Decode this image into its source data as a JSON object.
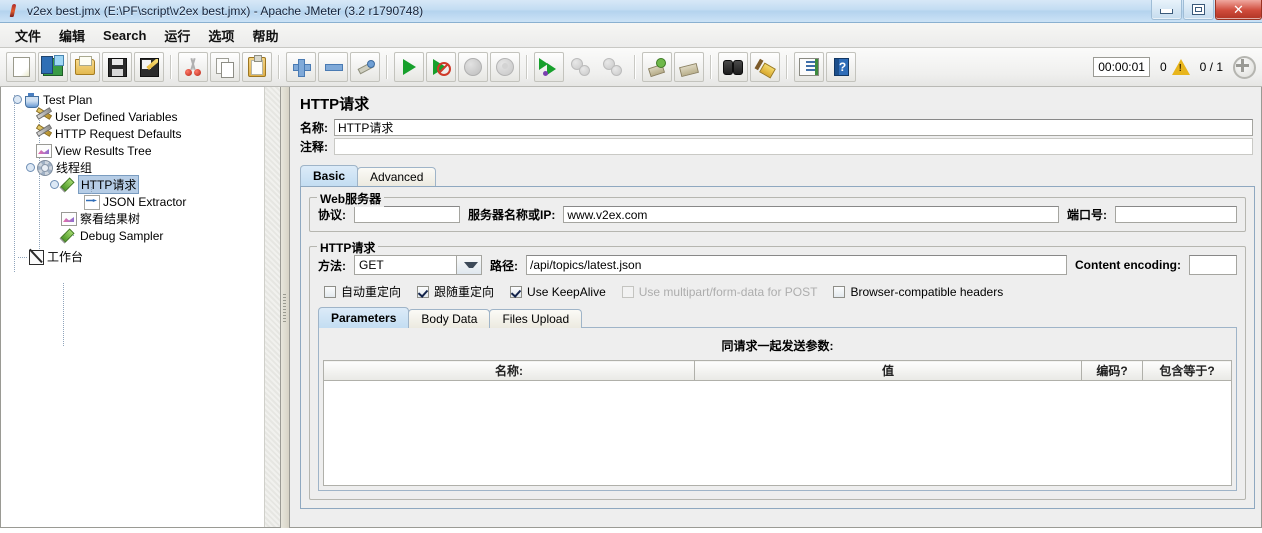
{
  "window": {
    "title": "v2ex best.jmx (E:\\PF\\script\\v2ex best.jmx) - Apache JMeter (3.2 r1790748)",
    "app_icon": "jmeter-feather-icon",
    "minimize_label": "",
    "maximize_label": "",
    "close_label": "✕"
  },
  "menubar": {
    "items": [
      {
        "label": "文件",
        "name": "menu-file"
      },
      {
        "label": "编辑",
        "name": "menu-edit"
      },
      {
        "label": "Search",
        "name": "menu-search"
      },
      {
        "label": "运行",
        "name": "menu-run"
      },
      {
        "label": "选项",
        "name": "menu-options"
      },
      {
        "label": "帮助",
        "name": "menu-help"
      }
    ]
  },
  "toolbar": {
    "buttons": [
      {
        "icon": "new-document-icon",
        "tooltip": "New"
      },
      {
        "icon": "templates-icon",
        "tooltip": "Templates"
      },
      {
        "icon": "open-folder-icon",
        "tooltip": "Open"
      },
      {
        "icon": "save-floppy-icon",
        "tooltip": "Save"
      },
      {
        "icon": "save-as-icon",
        "tooltip": "Save As"
      },
      {
        "icon": "cut-scissors-icon",
        "tooltip": "Cut"
      },
      {
        "icon": "copy-icon",
        "tooltip": "Copy"
      },
      {
        "icon": "paste-clipboard-icon",
        "tooltip": "Paste"
      },
      {
        "icon": "expand-plus-icon",
        "tooltip": "Expand All"
      },
      {
        "icon": "collapse-minus-icon",
        "tooltip": "Collapse All"
      },
      {
        "icon": "toggle-icon",
        "tooltip": "Toggle"
      },
      {
        "icon": "start-play-icon",
        "tooltip": "Start"
      },
      {
        "icon": "start-no-pauses-icon",
        "tooltip": "Start no pauses"
      },
      {
        "icon": "stop-circle-icon",
        "tooltip": "Stop"
      },
      {
        "icon": "shutdown-circle-icon",
        "tooltip": "Shutdown"
      },
      {
        "icon": "remote-start-all-icon",
        "tooltip": "Remote Start All"
      },
      {
        "icon": "remote-stop-all-icon",
        "tooltip": "Remote Stop All"
      },
      {
        "icon": "clear-icon",
        "tooltip": "Clear"
      },
      {
        "icon": "clear-all-icon",
        "tooltip": "Clear All"
      },
      {
        "icon": "search-binoculars-icon",
        "tooltip": "Search"
      },
      {
        "icon": "search-reset-broom-icon",
        "tooltip": "Reset Search"
      },
      {
        "icon": "function-helper-icon",
        "tooltip": "Function Helper Dialog"
      },
      {
        "icon": "help-book-icon",
        "tooltip": "Help"
      }
    ],
    "status": {
      "elapsed_time": "00:00:01",
      "warning_count": "0",
      "warning_icon": "warning-triangle-icon",
      "threads": "0 / 1",
      "connector_icon": "connection-status-icon"
    }
  },
  "tree": {
    "nodes": [
      {
        "label": "Test Plan",
        "icon": "test-plan-icon",
        "level": 0,
        "expanded": true,
        "selected": false,
        "name": "tree-node-test-plan"
      },
      {
        "label": "User Defined Variables",
        "icon": "config-element-icon",
        "level": 1,
        "expanded": null,
        "selected": false,
        "name": "tree-node-user-defined-variables"
      },
      {
        "label": "HTTP Request Defaults",
        "icon": "config-element-icon",
        "level": 1,
        "expanded": null,
        "selected": false,
        "name": "tree-node-http-request-defaults"
      },
      {
        "label": "View Results Tree",
        "icon": "listener-icon",
        "level": 1,
        "expanded": null,
        "selected": false,
        "name": "tree-node-view-results-tree"
      },
      {
        "label": "线程组",
        "icon": "thread-group-icon",
        "level": 1,
        "expanded": true,
        "selected": false,
        "name": "tree-node-thread-group"
      },
      {
        "label": "HTTP请求",
        "icon": "sampler-icon",
        "level": 2,
        "expanded": true,
        "selected": true,
        "name": "tree-node-http-request"
      },
      {
        "label": "JSON Extractor",
        "icon": "post-processor-icon",
        "level": 3,
        "expanded": null,
        "selected": false,
        "name": "tree-node-json-extractor"
      },
      {
        "label": "察看结果树",
        "icon": "listener-icon",
        "level": 2,
        "expanded": null,
        "selected": false,
        "name": "tree-node-view-results-tree-cn"
      },
      {
        "label": "Debug Sampler",
        "icon": "sampler-icon",
        "level": 2,
        "expanded": null,
        "selected": false,
        "name": "tree-node-debug-sampler"
      },
      {
        "label": "工作台",
        "icon": "workbench-icon",
        "level": 0,
        "expanded": null,
        "selected": false,
        "name": "tree-node-workbench"
      }
    ]
  },
  "detail": {
    "title": "HTTP请求",
    "name_label": "名称:",
    "name_value": "HTTP请求",
    "comment_label": "注释:",
    "comment_value": "",
    "tabs": [
      {
        "label": "Basic",
        "active": true
      },
      {
        "label": "Advanced",
        "active": false
      }
    ],
    "web_server": {
      "legend": "Web服务器",
      "protocol_label": "协议:",
      "protocol_value": "",
      "server_label": "服务器名称或IP:",
      "server_value": "www.v2ex.com",
      "port_label": "端口号:",
      "port_value": ""
    },
    "http_request": {
      "legend": "HTTP请求",
      "method_label": "方法:",
      "method_value": "GET",
      "path_label": "路径:",
      "path_value": "/api/topics/latest.json",
      "content_encoding_label": "Content encoding:",
      "content_encoding_value": ""
    },
    "checkboxes": [
      {
        "label": "自动重定向",
        "checked": false,
        "disabled": false,
        "name": "checkbox-auto-redirect"
      },
      {
        "label": "跟随重定向",
        "checked": true,
        "disabled": false,
        "name": "checkbox-follow-redirect"
      },
      {
        "label": "Use KeepAlive",
        "checked": true,
        "disabled": false,
        "name": "checkbox-use-keepalive"
      },
      {
        "label": "Use multipart/form-data for POST",
        "checked": false,
        "disabled": true,
        "name": "checkbox-use-multipart"
      },
      {
        "label": "Browser-compatible headers",
        "checked": false,
        "disabled": false,
        "name": "checkbox-browser-compatible-headers"
      }
    ],
    "inner_tabs": [
      {
        "label": "Parameters",
        "active": true
      },
      {
        "label": "Body Data",
        "active": false
      },
      {
        "label": "Files Upload",
        "active": false
      }
    ],
    "params": {
      "caption": "同请求一起发送参数:",
      "columns": [
        "名称:",
        "值",
        "编码?",
        "包含等于?"
      ],
      "rows": []
    }
  }
}
